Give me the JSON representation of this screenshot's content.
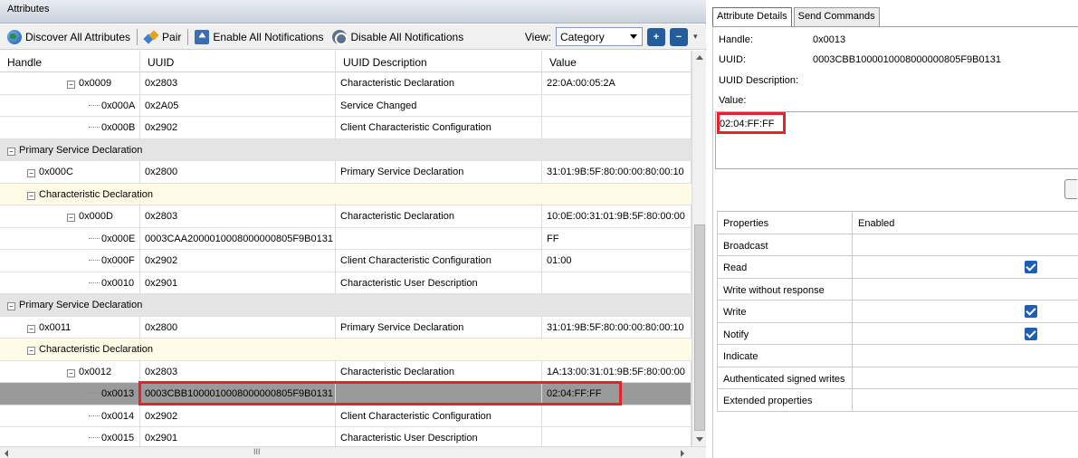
{
  "attributes_panel": {
    "title": "Attributes",
    "toolbar": {
      "discover": "Discover All Attributes",
      "pair": "Pair",
      "enable_notifications": "Enable All Notifications",
      "disable_notifications": "Disable All Notifications",
      "view_label": "View:",
      "view_value": "Category",
      "expand_icon": "expand-all-icon",
      "collapse_icon": "collapse-all-icon"
    },
    "columns": [
      "Handle",
      "UUID",
      "UUID Description",
      "Value"
    ],
    "rows": [
      {
        "kind": "attr",
        "handle": "0x0009",
        "uuid": "0x2803",
        "desc": "Characteristic Declaration",
        "value": "22:0A:00:05:2A"
      },
      {
        "kind": "attr",
        "handle": "0x000A",
        "uuid": "0x2A05",
        "desc": "Service Changed",
        "value": ""
      },
      {
        "kind": "attr",
        "handle": "0x000B",
        "uuid": "0x2902",
        "desc": "Client Characteristic Configuration",
        "value": ""
      },
      {
        "kind": "group",
        "label": "Primary Service Declaration"
      },
      {
        "kind": "attr",
        "handle": "0x000C",
        "uuid": "0x2800",
        "desc": "Primary Service Declaration",
        "value": "31:01:9B:5F:80:00:00:80:00:10"
      },
      {
        "kind": "subgroup",
        "label": "Characteristic Declaration"
      },
      {
        "kind": "attr",
        "handle": "0x000D",
        "uuid": "0x2803",
        "desc": "Characteristic Declaration",
        "value": "10:0E:00:31:01:9B:5F:80:00:00"
      },
      {
        "kind": "attr",
        "handle": "0x000E",
        "uuid": "0003CAA2000010008000000805F9B0131",
        "desc": "",
        "value": "FF"
      },
      {
        "kind": "attr",
        "handle": "0x000F",
        "uuid": "0x2902",
        "desc": "Client Characteristic Configuration",
        "value": "01:00"
      },
      {
        "kind": "attr",
        "handle": "0x0010",
        "uuid": "0x2901",
        "desc": "Characteristic User Description",
        "value": ""
      },
      {
        "kind": "group",
        "label": "Primary Service Declaration"
      },
      {
        "kind": "attr",
        "handle": "0x0011",
        "uuid": "0x2800",
        "desc": "Primary Service Declaration",
        "value": "31:01:9B:5F:80:00:00:80:00:10"
      },
      {
        "kind": "subgroup",
        "label": "Characteristic Declaration"
      },
      {
        "kind": "attr",
        "handle": "0x0012",
        "uuid": "0x2803",
        "desc": "Characteristic Declaration",
        "value": "1A:13:00:31:01:9B:5F:80:00:00"
      },
      {
        "kind": "attr",
        "handle": "0x0013",
        "uuid": "0003CBB1000010008000000805F9B0131",
        "desc": "",
        "value": "02:04:FF:FF"
      },
      {
        "kind": "attr",
        "handle": "0x0014",
        "uuid": "0x2902",
        "desc": "Client Characteristic Configuration",
        "value": ""
      },
      {
        "kind": "attr",
        "handle": "0x0015",
        "uuid": "0x2901",
        "desc": "Characteristic User Description",
        "value": ""
      }
    ],
    "hscroll_grip": "III"
  },
  "details_panel": {
    "tabs": [
      "Attribute Details",
      "Send Commands"
    ],
    "handle_label": "Handle:",
    "handle_value": "0x0013",
    "uuid_label": "UUID:",
    "uuid_value": "0003CBB1000010008000000805F9B0131",
    "uuid_desc_label": "UUID Description:",
    "uuid_desc_value": "",
    "value_label": "Value:",
    "value": "02:04:FF:FF",
    "properties_header": [
      "Properties",
      "Enabled"
    ],
    "properties": [
      {
        "name": "Broadcast",
        "enabled": false
      },
      {
        "name": "Read",
        "enabled": true
      },
      {
        "name": "Write without response",
        "enabled": false
      },
      {
        "name": "Write",
        "enabled": true
      },
      {
        "name": "Notify",
        "enabled": true
      },
      {
        "name": "Indicate",
        "enabled": false
      },
      {
        "name": "Authenticated signed writes",
        "enabled": false
      },
      {
        "name": "Extended properties",
        "enabled": false
      }
    ]
  },
  "colors": {
    "highlight": "#e8212b",
    "selected_row": "#9a9a9a",
    "group_row": "#e4e4e4",
    "subgroup_row": "#fefce6",
    "checkbox": "#1e5fb5"
  }
}
